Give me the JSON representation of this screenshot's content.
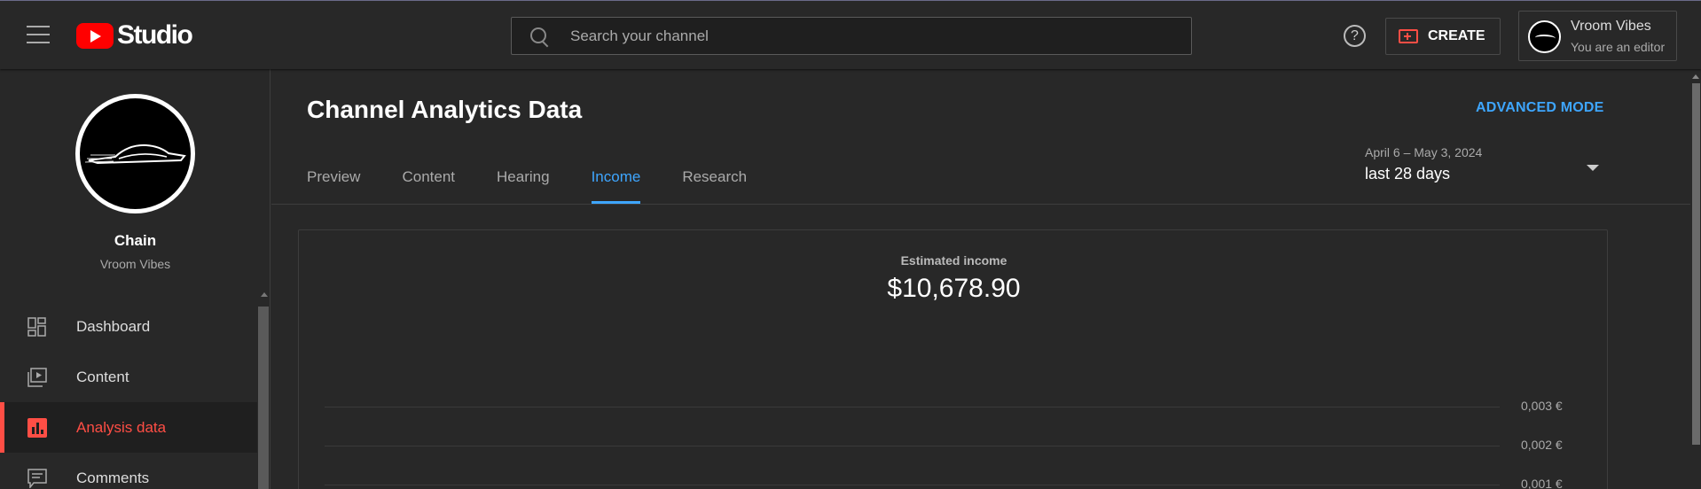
{
  "header": {
    "logo_text": "Studio",
    "search_placeholder": "Search your channel",
    "create_label": "CREATE",
    "account_name": "Vroom Vibes",
    "account_role": "You are an editor"
  },
  "sidebar": {
    "profile_name": "Chain",
    "channel_name": "Vroom Vibes",
    "items": [
      {
        "label": "Dashboard",
        "icon": "dashboard-icon"
      },
      {
        "label": "Content",
        "icon": "content-icon"
      },
      {
        "label": "Analysis data",
        "icon": "analytics-icon",
        "active": true
      },
      {
        "label": "Comments",
        "icon": "comments-icon"
      }
    ]
  },
  "main": {
    "title": "Channel Analytics Data",
    "advanced_mode": "ADVANCED MODE",
    "tabs": [
      {
        "label": "Preview"
      },
      {
        "label": "Content"
      },
      {
        "label": "Hearing"
      },
      {
        "label": "Income",
        "active": true
      },
      {
        "label": "Research"
      }
    ],
    "date_range": {
      "dates": "April 6 – May 3, 2024",
      "period": "last 28 days"
    },
    "metric": {
      "label": "Estimated income",
      "value": "$10,678.90"
    },
    "axis_ticks": [
      "0,003 €",
      "0,002 €",
      "0,001 €"
    ]
  },
  "colors": {
    "accent_blue": "#3ea6ff",
    "active_red": "#ff4e45",
    "youtube_red": "#ff0000",
    "background": "#282828"
  }
}
